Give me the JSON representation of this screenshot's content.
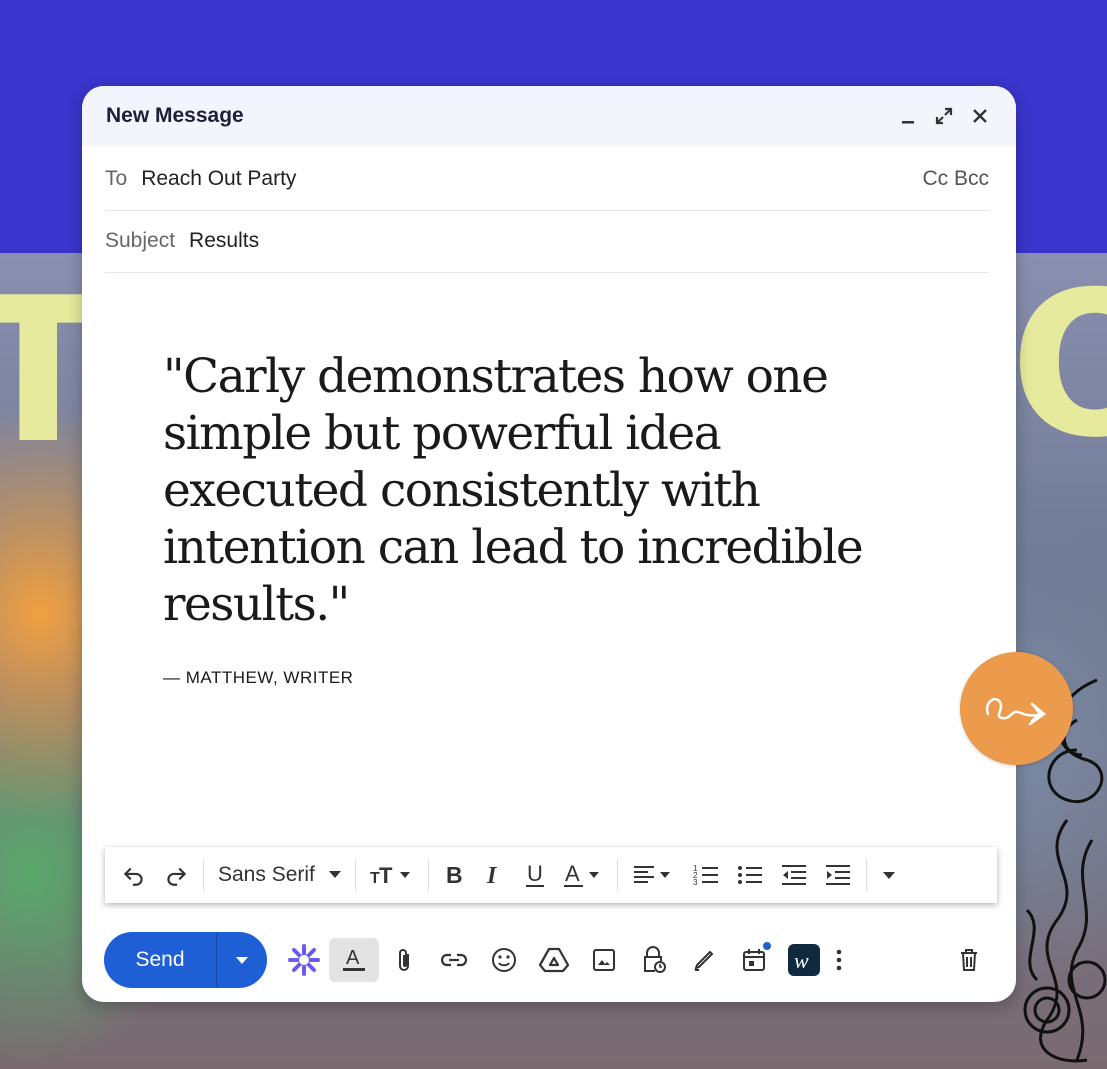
{
  "window": {
    "title": "New Message",
    "controls": {
      "minimize": "minimize-icon",
      "expand": "expand-icon",
      "close": "close-icon"
    }
  },
  "to": {
    "label": "To",
    "value": "Reach Out Party",
    "cc_bcc": "Cc Bcc"
  },
  "subject": {
    "label": "Subject",
    "value": "Results"
  },
  "body": {
    "quote": "\"Carly demonstrates how one simple but powerful idea executed consistently with intention can lead to incredible results.\"",
    "attribution": "— MATTHEW, WRITER"
  },
  "formatting": {
    "font": "Sans Serif",
    "buttons": [
      "undo-icon",
      "redo-icon",
      "text-size-icon",
      "bold-icon",
      "italic-icon",
      "underline-icon",
      "text-color-icon",
      "align-icon",
      "numbered-list-icon",
      "bulleted-list-icon",
      "indent-less-icon",
      "indent-more-icon",
      "more-formatting-icon"
    ]
  },
  "footer": {
    "send_label": "Send",
    "tools": [
      "ai-sparkle-icon",
      "formatting-toggle-icon",
      "attach-icon",
      "link-icon",
      "emoji-icon",
      "drive-icon",
      "photo-icon",
      "confidential-icon",
      "signature-icon",
      "schedule-icon",
      "writer-extension-icon",
      "more-options-icon",
      "discard-icon"
    ]
  },
  "colors": {
    "accent": "#1e5fd6",
    "background_top": "#3a35cc",
    "fab": "#ec9a4b",
    "header": "#f2f6fc",
    "decor_text": "#e6ea9c"
  }
}
